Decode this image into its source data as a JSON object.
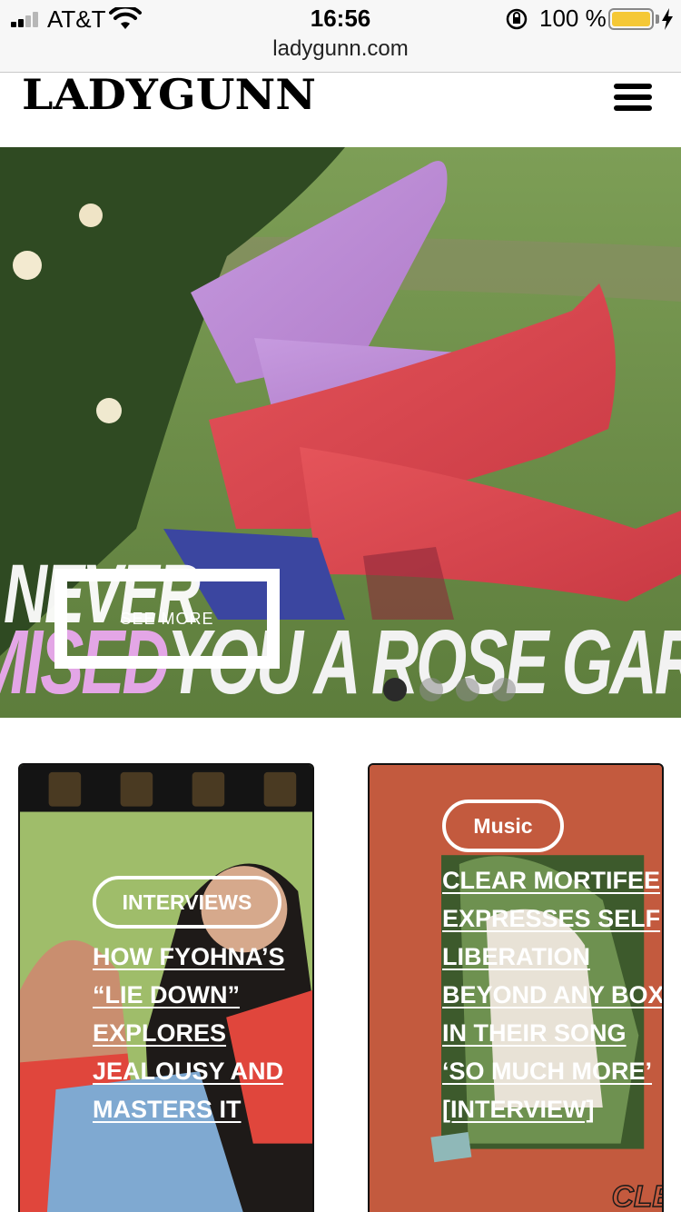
{
  "status_bar": {
    "carrier": "AT&T",
    "time": "16:56",
    "battery_percent": "100 %",
    "battery_level": 1.0,
    "signal_bars_active": 2,
    "signal_bars_total": 4,
    "battery_color": "#f5c836"
  },
  "browser": {
    "url": "ladygunn.com"
  },
  "header": {
    "logo_text": "LADYGUNN",
    "menu_icon": "hamburger-icon"
  },
  "hero": {
    "headline_line1": "NEVER",
    "headline_line2_pink": "MISED",
    "headline_line2_white": "YOU A  ROSE GARD",
    "cta_label": "SEE MORE",
    "slides_total": 4,
    "active_slide": 1,
    "accent_pink": "#e3a6e6"
  },
  "cards": [
    {
      "tag": "INTERVIEWS",
      "title_lines": [
        "HOW FYOHNA’S",
        "“LIE DOWN”",
        "EXPLORES",
        "JEALOUSY AND",
        "MASTERS IT"
      ]
    },
    {
      "tag": "Music",
      "title_lines": [
        "CLEAR MORTIFEE",
        "EXPRESSES SELF",
        "LIBERATION",
        "BEYOND ANY BOX",
        "IN THEIR SONG",
        "‘SO MUCH MORE’",
        "[INTERVIEW]"
      ]
    }
  ]
}
